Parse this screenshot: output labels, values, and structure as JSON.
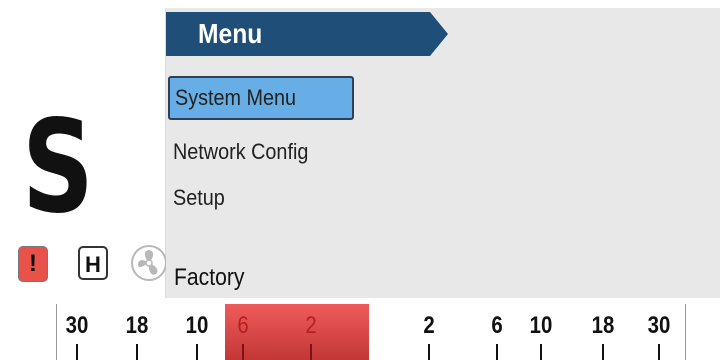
{
  "status": {
    "mode_letter": "S",
    "alarm_badge": "!",
    "hold_badge": "H",
    "icons": [
      "alarm-icon",
      "hold-icon",
      "fan-icon"
    ],
    "colors": {
      "alarm": "#e9524a",
      "accent": "#1f4e79"
    }
  },
  "menu": {
    "title": "Menu",
    "items": [
      {
        "label": "System Menu",
        "selected": true
      },
      {
        "label": "Network Config",
        "selected": false
      },
      {
        "label": "Setup",
        "selected": false
      }
    ],
    "factory_label": "Factory",
    "selection_color": "#67aee6"
  },
  "scale": {
    "ticks": [
      "30",
      "18",
      "10",
      "6",
      "2",
      "2",
      "6",
      "10",
      "18",
      "30"
    ],
    "highlight_color": "#e14b4b"
  }
}
